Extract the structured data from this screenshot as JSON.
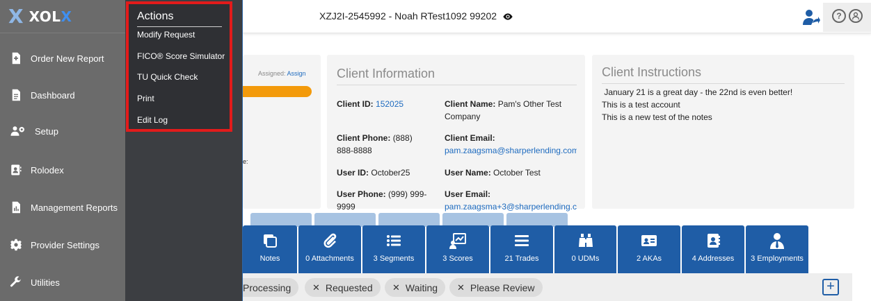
{
  "app": {
    "logo_text_a": "XOL",
    "logo_text_b": "X"
  },
  "sidebar": {
    "items": [
      {
        "label": "Order New Report",
        "icon": "file-plus-icon"
      },
      {
        "label": "Dashboard",
        "icon": "document-icon"
      },
      {
        "label": "Setup",
        "icon": "users-gear-icon"
      },
      {
        "label": "Rolodex",
        "icon": "address-book-icon"
      },
      {
        "label": "Management Reports",
        "icon": "report-icon"
      },
      {
        "label": "Provider Settings",
        "icon": "gear-icon"
      },
      {
        "label": "Utilities",
        "icon": "wrench-icon"
      }
    ]
  },
  "actions": {
    "title": "Actions",
    "items": [
      "Modify Request",
      "FICO® Score Simulator",
      "TU Quick Check",
      "Print",
      "Edit Log"
    ]
  },
  "topbar": {
    "title": "XZJ2I-2545992 - Noah RTest1092 99202"
  },
  "status_card": {
    "assigned_label": "Assigned:",
    "assign_link": "Assign",
    "partial_label": "e:"
  },
  "client_info": {
    "title": "Client Information",
    "client_id_label": "Client ID:",
    "client_id": "152025",
    "client_name_label": "Client Name:",
    "client_name_1": "Pam's Other Test",
    "client_name_2": "Company",
    "client_phone_label": "Client Phone:",
    "client_phone_1": "(888)",
    "client_phone_2": "888-8888",
    "client_email_label": "Client Email:",
    "client_email": "pam.zaagsma@sharperlending.com",
    "user_id_label": "User ID:",
    "user_id": "October25",
    "user_name_label": "User Name:",
    "user_name": "October Test",
    "user_phone_label": "User Phone:",
    "user_phone_1": "(999) 999-",
    "user_phone_2": "9999",
    "user_email_label": "User Email:",
    "user_email": "pam.zaagsma+3@sharperlending.c"
  },
  "client_instructions": {
    "title": "Client Instructions",
    "lines": [
      " January 21 is a great day - the 22nd is even better!",
      "This is a test account",
      "This is a new test of the notes"
    ]
  },
  "tabs": [
    {
      "label": "Notes",
      "icon": "notes-icon"
    },
    {
      "label": "0 Attachments",
      "icon": "paperclip-icon"
    },
    {
      "label": "3 Segments",
      "icon": "list-icon"
    },
    {
      "label": "3 Scores",
      "icon": "chart-board-icon"
    },
    {
      "label": "21 Trades",
      "icon": "bars-icon"
    },
    {
      "label": "0 UDMs",
      "icon": "binoculars-icon"
    },
    {
      "label": "2 AKAs",
      "icon": "id-card-icon"
    },
    {
      "label": "4 Addresses",
      "icon": "address-book-icon"
    },
    {
      "label": "3 Employments",
      "icon": "employee-icon"
    }
  ],
  "filters": {
    "chips": [
      "Processing",
      "Requested",
      "Waiting",
      "Please Review"
    ],
    "add_label": "+"
  }
}
